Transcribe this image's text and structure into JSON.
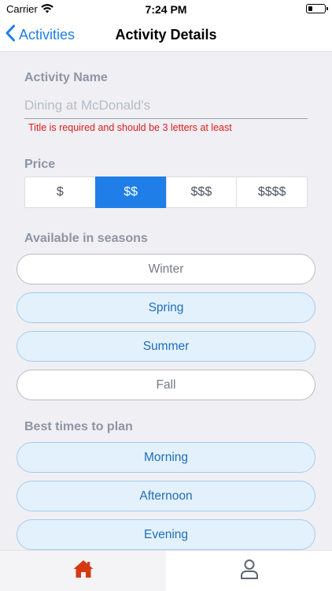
{
  "status_bar": {
    "carrier": "Carrier",
    "time": "7:24 PM"
  },
  "nav": {
    "back_label": "Activities",
    "title": "Activity Details"
  },
  "form": {
    "name_label": "Activity Name",
    "name_value": "",
    "name_placeholder": "Dining at McDonald's",
    "name_error": "Title is required and should be 3 letters at least",
    "price_label": "Price",
    "price_options": [
      "$",
      "$$",
      "$$$",
      "$$$$"
    ],
    "price_selected": "$$",
    "seasons_label": "Available in seasons",
    "seasons": [
      {
        "label": "Winter",
        "selected": false
      },
      {
        "label": "Spring",
        "selected": true
      },
      {
        "label": "Summer",
        "selected": true
      },
      {
        "label": "Fall",
        "selected": false
      }
    ],
    "times_label": "Best times to plan",
    "times": [
      {
        "label": "Morning",
        "selected": true
      },
      {
        "label": "Afternoon",
        "selected": true
      },
      {
        "label": "Evening",
        "selected": true
      }
    ]
  },
  "tab_bar": {
    "tabs": [
      {
        "icon": "home-icon",
        "active": true
      },
      {
        "icon": "profile-icon",
        "active": false
      }
    ]
  },
  "colors": {
    "accent": "#1f7ee8",
    "error": "#e11b1b",
    "home_icon": "#d63a12",
    "pill_selected_bg": "#e3f1fd"
  }
}
